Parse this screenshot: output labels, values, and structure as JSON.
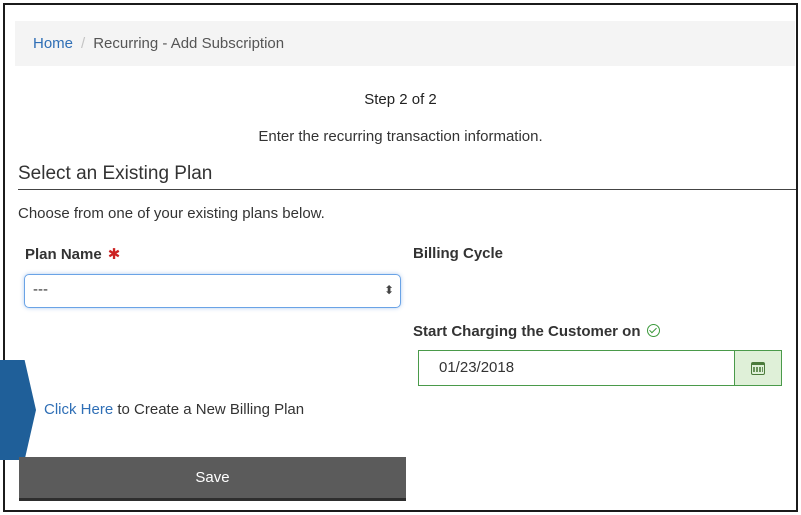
{
  "breadcrumb": {
    "home": "Home",
    "separator": "/",
    "current": "Recurring - Add Subscription"
  },
  "step": {
    "title": "Step 2 of 2",
    "description": "Enter the recurring transaction information."
  },
  "section": {
    "title": "Select an Existing Plan",
    "description": "Choose from one of your existing plans below."
  },
  "plan": {
    "label": "Plan Name",
    "required_mark": "✱",
    "selected": "---"
  },
  "billing": {
    "label": "Billing Cycle"
  },
  "start": {
    "label": "Start Charging the Customer on",
    "date": "01/23/2018"
  },
  "create": {
    "link_text": "Click Here",
    "rest_text": " to Create a New Billing Plan"
  },
  "save_label": "Save",
  "colors": {
    "link": "#2f6fb6",
    "required": "#cc2222",
    "valid": "#4a9a4a",
    "button": "#5b5b5b",
    "pointer": "#1f5f99"
  },
  "icons": [
    "check-circle-icon",
    "calendar-icon",
    "select-arrows-icon"
  ]
}
